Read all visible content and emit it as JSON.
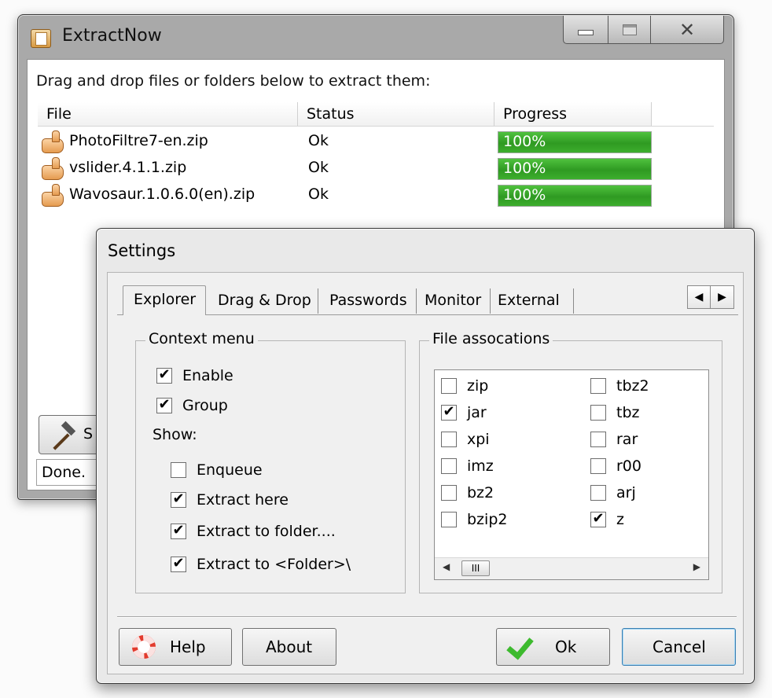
{
  "main_window": {
    "title": "ExtractNow",
    "caption_buttons": {
      "close": "✕"
    },
    "drop_hint": "Drag and drop files or folders below to extract them:",
    "columns": [
      "File",
      "Status",
      "Progress"
    ],
    "rows": [
      {
        "file": "PhotoFiltre7-en.zip",
        "status": "Ok",
        "progress_label": "100%",
        "progress": 100
      },
      {
        "file": "vslider.4.1.1.zip",
        "status": "Ok",
        "progress_label": "100%",
        "progress": 100
      },
      {
        "file": "Wavosaur.1.0.6.0(en).zip",
        "status": "Ok",
        "progress_label": "100%",
        "progress": 100
      }
    ],
    "settings_button_partial": "S",
    "status_text": "Done."
  },
  "settings": {
    "title": "Settings",
    "tabs": [
      "Explorer",
      "Drag & Drop",
      "Passwords",
      "Monitor",
      "External"
    ],
    "active_tab": "Explorer",
    "tab_scroll": {
      "left": "◀",
      "right": "▶"
    },
    "context_menu": {
      "title": "Context menu",
      "enable": {
        "label": "Enable",
        "checked": true
      },
      "group": {
        "label": "Group",
        "checked": true
      },
      "show_label": "Show:",
      "show_items": [
        {
          "label": "Enqueue",
          "checked": false
        },
        {
          "label": "Extract here",
          "checked": true
        },
        {
          "label": "Extract to folder....",
          "checked": true
        },
        {
          "label": "Extract to <Folder>\\",
          "checked": true
        }
      ]
    },
    "file_associations": {
      "title": "File assocations",
      "col1": [
        {
          "label": "zip",
          "checked": false
        },
        {
          "label": "jar",
          "checked": true
        },
        {
          "label": "xpi",
          "checked": false
        },
        {
          "label": "imz",
          "checked": false
        },
        {
          "label": "bz2",
          "checked": false
        },
        {
          "label": "bzip2",
          "checked": false
        }
      ],
      "col2": [
        {
          "label": "tbz2",
          "checked": false
        },
        {
          "label": "tbz",
          "checked": false
        },
        {
          "label": "rar",
          "checked": false
        },
        {
          "label": "r00",
          "checked": false
        },
        {
          "label": "arj",
          "checked": false
        },
        {
          "label": "z",
          "checked": true
        }
      ],
      "scroll": {
        "left": "◀",
        "thumb": "III",
        "right": "▶"
      }
    },
    "buttons": {
      "help": "Help",
      "about": "About",
      "ok": "Ok",
      "cancel": "Cancel"
    },
    "check_glyph": "✔"
  }
}
